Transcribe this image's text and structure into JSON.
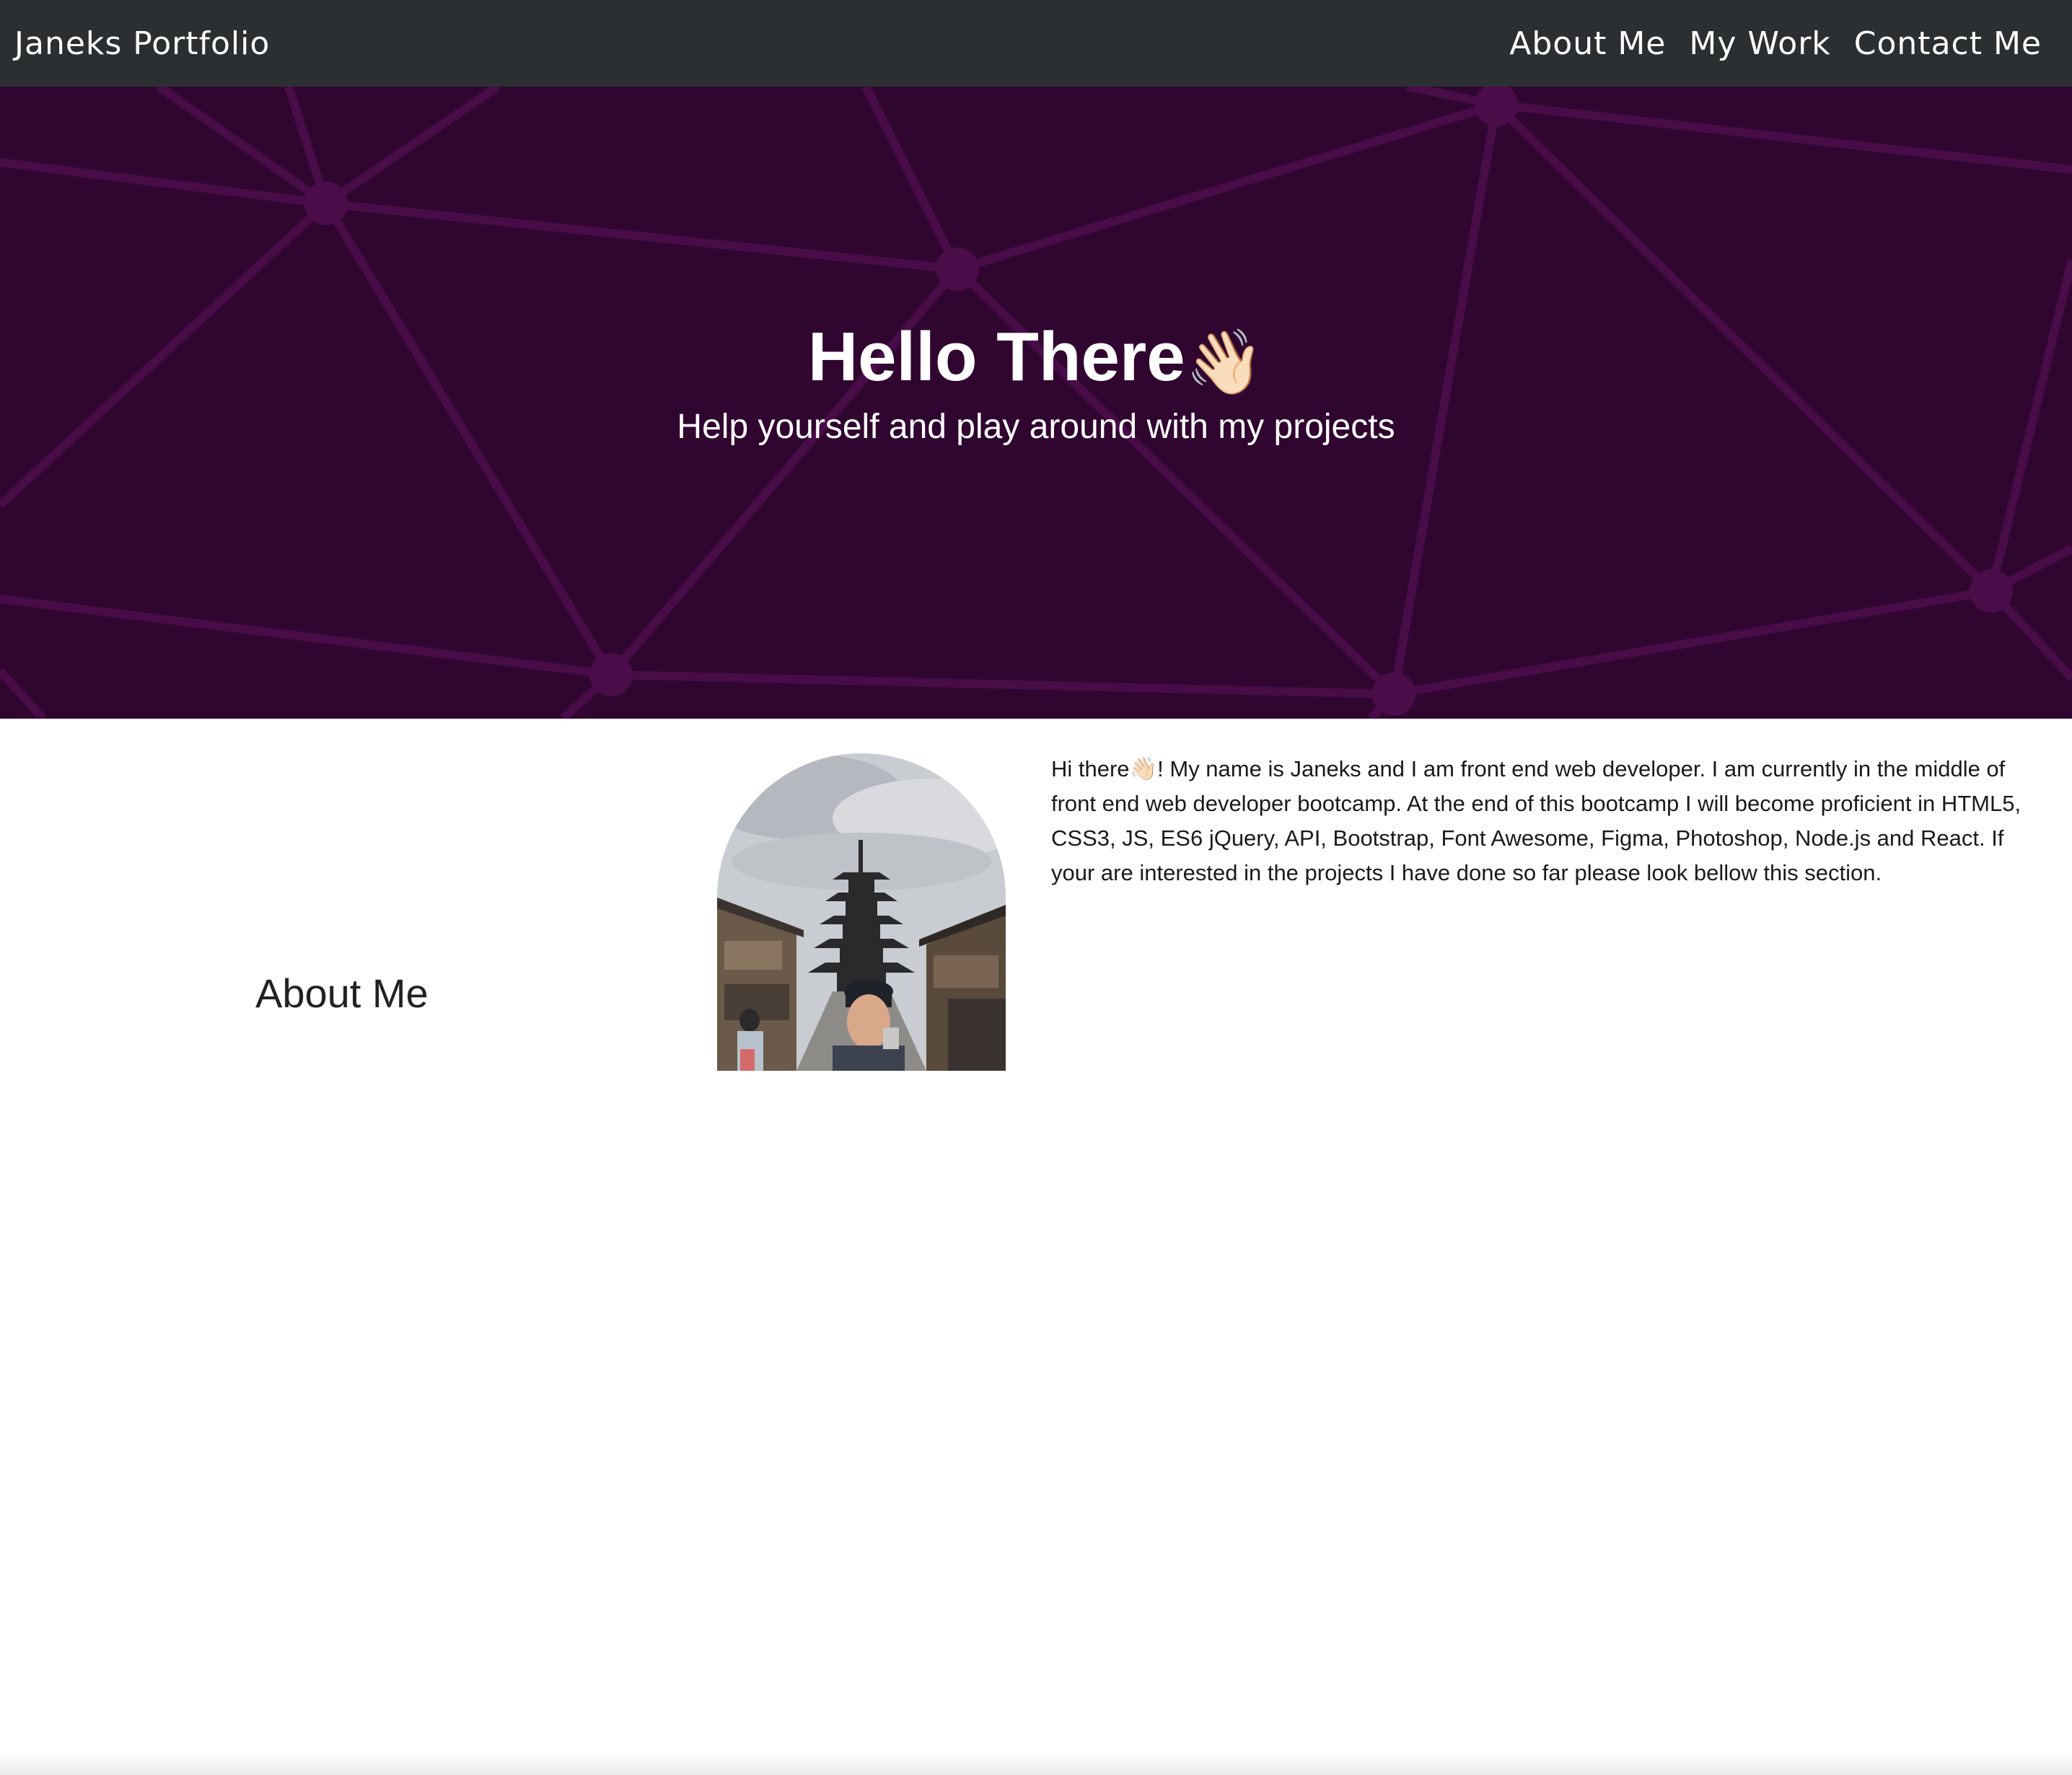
{
  "navbar": {
    "brand": "Janeks Portfolio",
    "links": [
      {
        "label": "About Me"
      },
      {
        "label": "My Work"
      },
      {
        "label": "Contact Me"
      }
    ]
  },
  "hero": {
    "title": "Hello There",
    "title_emoji": "👋🏻",
    "subtitle": "Help yourself and play around with my projects",
    "background_color": "#300630",
    "pattern_color": "#4a0d4a"
  },
  "about": {
    "heading": "About Me",
    "bio": "Hi there👋🏻! My name is Janeks and I am front end web developer. I am currently in the middle of front end web developer bootcamp. At the end of this bootcamp I will become proficient in HTML5, CSS3, JS, ES6 jQuery, API, Bootstrap, Font Awesome, Figma, Photoshop, Node.js and React. If your are interested in the projects I have done so far please look bellow this section.",
    "portrait_icon": "profile-photo"
  },
  "colors": {
    "navbar_bg": "#2c2f31",
    "text_light": "#ffffff",
    "text_dark": "#1a1a1a"
  }
}
